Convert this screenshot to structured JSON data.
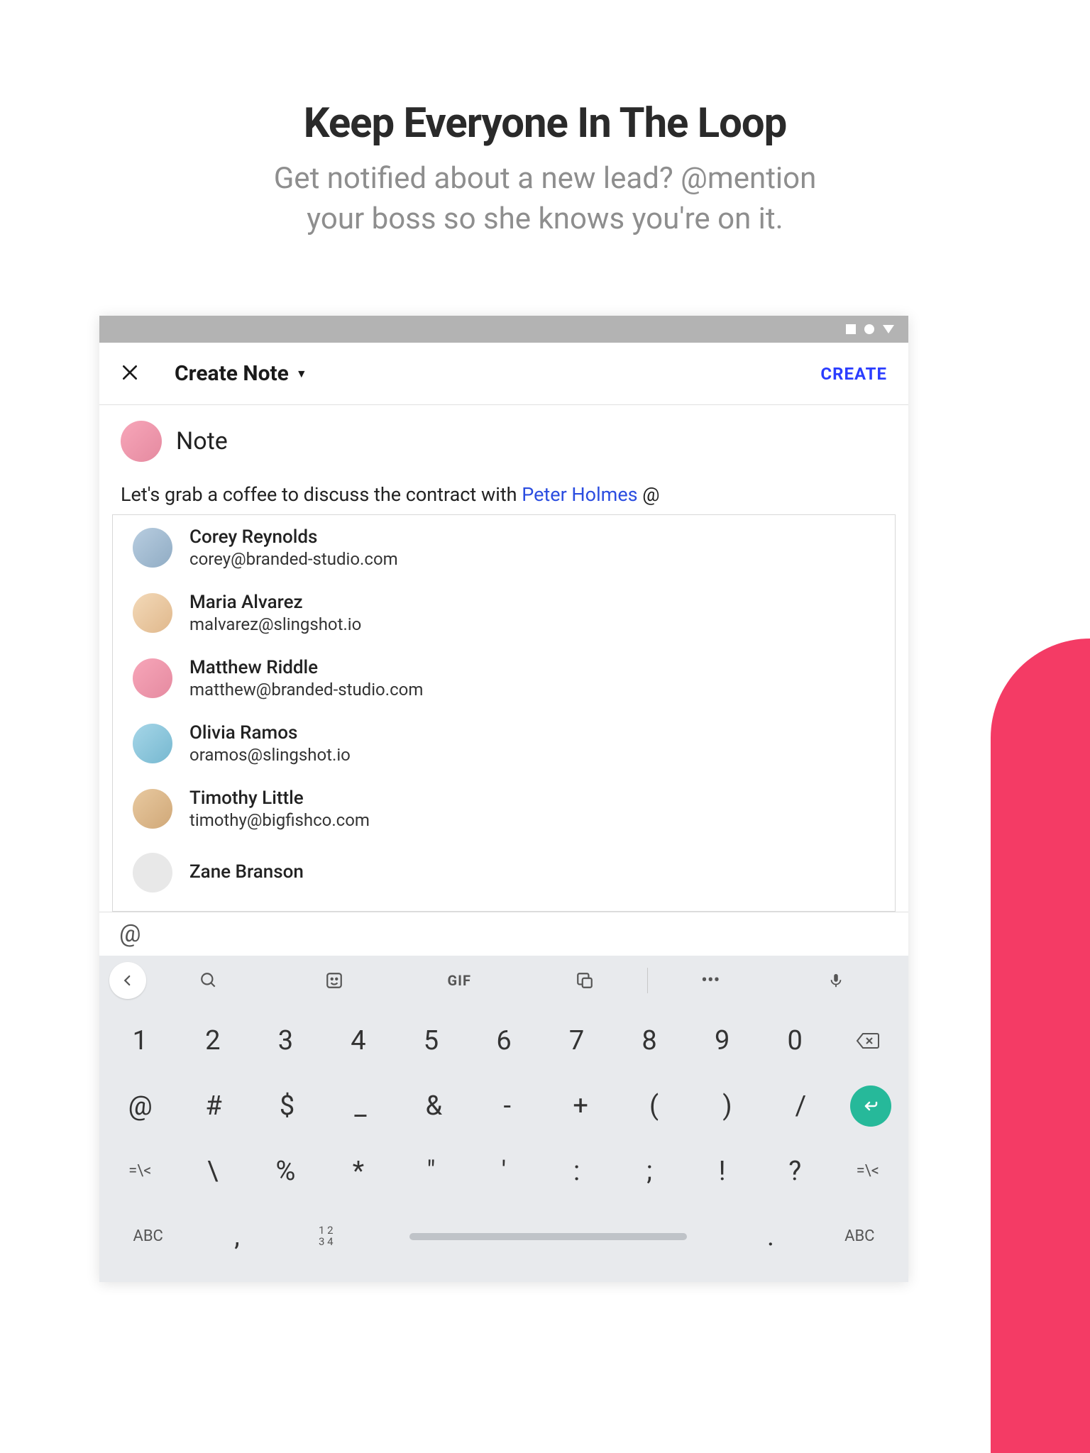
{
  "hero": {
    "title": "Keep Everyone In The Loop",
    "subtitle_line1": "Get notified about a new lead? @mention",
    "subtitle_line2": "your boss so she knows you're on it."
  },
  "appbar": {
    "title": "Create Note",
    "action": "CREATE"
  },
  "note": {
    "section_label": "Note",
    "text_before": "Let's grab a coffee to discuss the contract with ",
    "mention": "Peter Holmes",
    "text_after": " @"
  },
  "suggestions": [
    {
      "name": "Corey Reynolds",
      "email": "corey@branded-studio.com"
    },
    {
      "name": "Maria Alvarez",
      "email": "malvarez@slingshot.io"
    },
    {
      "name": "Matthew Riddle",
      "email": "matthew@branded-studio.com"
    },
    {
      "name": "Olivia Ramos",
      "email": "oramos@slingshot.io"
    },
    {
      "name": "Timothy Little",
      "email": "timothy@bigfishco.com"
    },
    {
      "name": "Zane Branson",
      "email": ""
    }
  ],
  "autocomplete": {
    "text": "@"
  },
  "keyboard": {
    "tools": {
      "gif": "GIF"
    },
    "row1": [
      "1",
      "2",
      "3",
      "4",
      "5",
      "6",
      "7",
      "8",
      "9",
      "0"
    ],
    "row2": [
      "@",
      "#",
      "$",
      "_",
      "&",
      "-",
      "+",
      "(",
      ")",
      "/"
    ],
    "row3_left": "=\\<",
    "row3": [
      "\\",
      "%",
      "*",
      "\"",
      "'",
      ":",
      ";",
      "!",
      "?"
    ],
    "row3_right": "=\\<",
    "row4": {
      "abc_left": "ABC",
      "comma": ",",
      "numswitch": "1 2\n3 4",
      "dot": ".",
      "abc_right": "ABC"
    }
  }
}
